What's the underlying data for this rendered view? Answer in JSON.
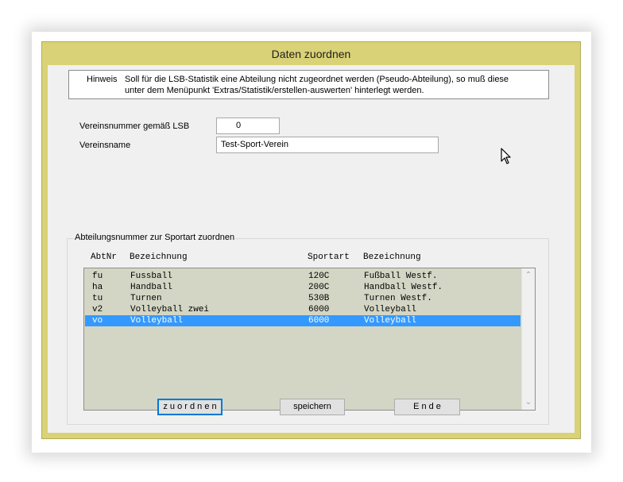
{
  "window": {
    "title": "Daten zuordnen"
  },
  "hint": {
    "label": "Hinweis",
    "line1": "Soll für die LSB-Statistik eine Abteilung nicht zugeordnet werden (Pseudo-Abteilung), so muß diese",
    "line2": "unter dem Menüpunkt 'Extras/Statistik/erstellen-auswerten' hinterlegt werden."
  },
  "form": {
    "vereinsnummer_label": "Vereinsnummer gemäß LSB",
    "vereinsnummer_value": "0",
    "vereinsname_label": "Vereinsname",
    "vereinsname_value": "Test-Sport-Verein"
  },
  "group": {
    "label": "Abteilungsnummer zur Sportart zuordnen",
    "columns": [
      "AbtNr",
      "Bezeichnung",
      "Sportart",
      "Bezeichnung"
    ],
    "rows": [
      [
        "fu",
        "Fussball",
        "120C",
        "Fußball Westf."
      ],
      [
        "ha",
        "Handball",
        "200C",
        "Handball Westf."
      ],
      [
        "tu",
        "Turnen",
        "530B",
        "Turnen Westf."
      ],
      [
        "v2",
        "Volleyball zwei",
        "6000",
        "Volleyball"
      ],
      [
        "vo",
        "Volleyball",
        "6000",
        "Volleyball"
      ]
    ],
    "selected_row": "vo"
  },
  "buttons": {
    "zuordnen": "z u o r d n e n",
    "speichern": "speichern",
    "ende": "E n d e"
  },
  "icons": {
    "scroll_up": "chevron-up-icon",
    "scroll_down": "chevron-down-icon",
    "cursor": "mouse-pointer-icon"
  },
  "colors": {
    "window_frame": "#d9d277",
    "list_background": "#d4d6c5",
    "selection": "#3399ff"
  }
}
